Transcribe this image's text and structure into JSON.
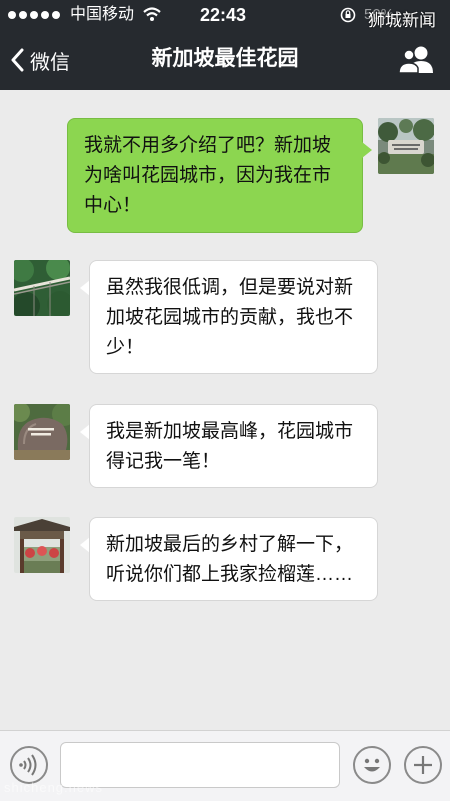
{
  "status_bar": {
    "carrier": "中国移动",
    "time": "22:43",
    "battery": "50%",
    "watermark": "狮城新闻"
  },
  "nav": {
    "back_label": "微信",
    "title": "新加坡最佳花园"
  },
  "messages": [
    {
      "side": "right",
      "avatar": "park-entrance-avatar",
      "text": "我就不用多介绍了吧？新加坡为啥叫花园城市，因为我在市中心！"
    },
    {
      "side": "left",
      "avatar": "treetop-walk-avatar",
      "text": "虽然我很低调，但是要说对新加坡花园城市的贡献，我也不少！"
    },
    {
      "side": "left",
      "avatar": "summit-stone-avatar",
      "text": "我是新加坡最高峰，花园城市得记我一笔！"
    },
    {
      "side": "left",
      "avatar": "village-gate-avatar",
      "text": "新加坡最后的乡村了解一下，听说你们都上我家捡榴莲……"
    }
  ],
  "input_bar": {
    "input_value": "",
    "input_placeholder": "",
    "voice_icon": "voice-icon",
    "emoji_icon": "emoji-icon",
    "plus_icon": "plus-icon"
  },
  "footer_watermark": "shicheng.news",
  "colors": {
    "nav_bg": "#262a2f",
    "chat_bg": "#ebebeb",
    "sent_bubble": "#8cd650",
    "received_bubble": "#ffffff"
  }
}
